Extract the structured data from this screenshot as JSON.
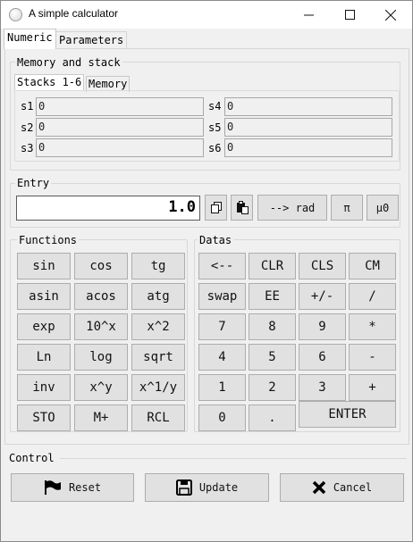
{
  "window": {
    "title": "A simple calculator"
  },
  "tabs": [
    "Numeric",
    "Parameters"
  ],
  "memory": {
    "group_label": "Memory and stack",
    "subtabs": [
      "Stacks 1-6",
      "Memory"
    ],
    "stacks": [
      {
        "label": "s1",
        "value": "0"
      },
      {
        "label": "s2",
        "value": "0"
      },
      {
        "label": "s3",
        "value": "0"
      },
      {
        "label": "s4",
        "value": "0"
      },
      {
        "label": "s5",
        "value": "0"
      },
      {
        "label": "s6",
        "value": "0"
      }
    ]
  },
  "entry": {
    "group_label": "Entry",
    "value": "1.0",
    "rad_label": "--> rad",
    "pi_label": "π",
    "mu0_label": "μ0",
    "icons": [
      "copy-icon",
      "paste-icon"
    ]
  },
  "functions": {
    "group_label": "Functions",
    "buttons": [
      "sin",
      "cos",
      "tg",
      "asin",
      "acos",
      "atg",
      "exp",
      "10^x",
      "x^2",
      "Ln",
      "log",
      "sqrt",
      "inv",
      "x^y",
      "x^1/y",
      "STO",
      "M+",
      "RCL"
    ]
  },
  "datas": {
    "group_label": "Datas",
    "buttons": [
      "<--",
      "CLR",
      "CLS",
      "CM",
      "swap",
      "EE",
      "+/-",
      "/",
      "7",
      "8",
      "9",
      "*",
      "4",
      "5",
      "6",
      "-",
      "1",
      "2",
      "3",
      "+",
      "0",
      "."
    ],
    "enter_label": "ENTER"
  },
  "control": {
    "label": "Control",
    "reset_label": "Reset",
    "update_label": "Update",
    "cancel_label": "Cancel",
    "icons": [
      "flag-icon",
      "save-icon",
      "close-icon"
    ]
  }
}
